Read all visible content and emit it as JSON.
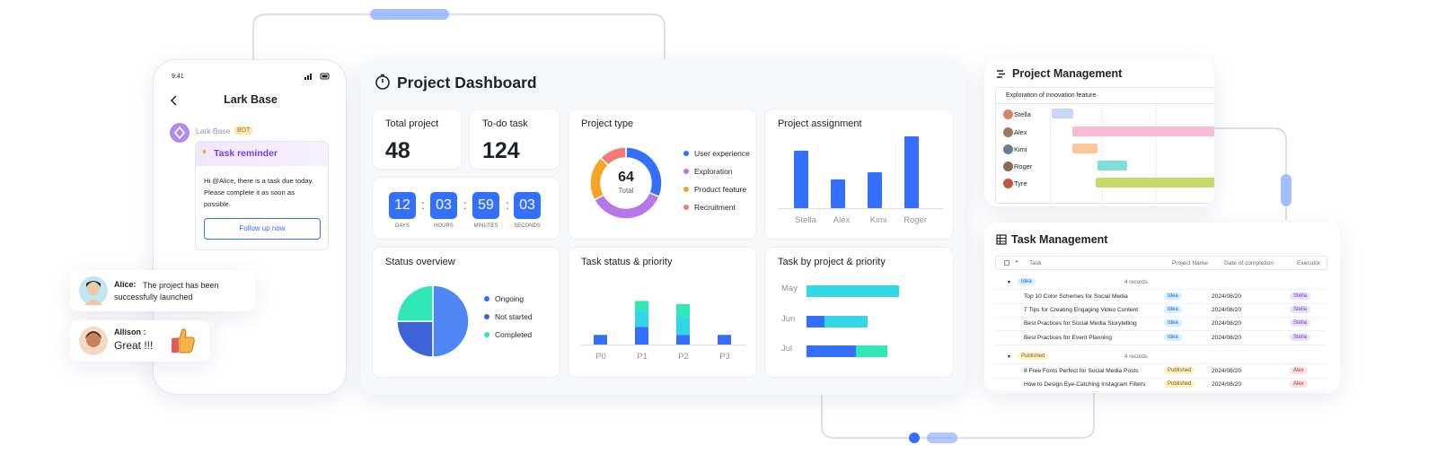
{
  "colors": {
    "accent": "#3370ff",
    "teal": "#2dd4bf",
    "cyan": "#33d6e6",
    "purple": "#b678e8",
    "orange": "#f5a524",
    "coral": "#f37b73"
  },
  "phone": {
    "time": "9:41",
    "title": "Lark Base",
    "back_icon": "chevron-left-icon",
    "bot_name": "Lark Base",
    "bot_badge": "BOT",
    "reminder_title": "Task reminder",
    "reminder_icon": "bell-icon",
    "reminder_text": "Hi @Alice, there is a task due today. Please complete it as soon as possible.",
    "button": "Follow up now"
  },
  "bubbles": [
    {
      "name": "Alice:",
      "text": "The project has been successfully launched"
    },
    {
      "name": "Allison :",
      "text": "Great !!!",
      "emoji": "thumbs-up-icon"
    }
  ],
  "dashboard": {
    "title": "Project Dashboard",
    "title_icon": "stopwatch-icon",
    "total_project": {
      "label": "Total project",
      "value": "48"
    },
    "todo_task": {
      "label": "To-do task",
      "value": "124"
    },
    "countdown": [
      {
        "value": "12",
        "label": "DAYS"
      },
      {
        "value": "03",
        "label": "HOURS"
      },
      {
        "value": "59",
        "label": "MINUTES"
      },
      {
        "value": "03",
        "label": "SECONDS"
      }
    ],
    "project_type": {
      "title": "Project type",
      "center_value": "64",
      "center_label": "Total",
      "legend": [
        "User experience",
        "Exploration",
        "Product feature",
        "Recruitment"
      ]
    },
    "status_overview": {
      "title": "Status overview",
      "legend": [
        "Ongoing",
        "Not started",
        "Completed"
      ]
    },
    "project_assignment": {
      "title": "Project assignment"
    },
    "task_status_priority": {
      "title": "Task status & priority"
    },
    "task_by_project": {
      "title": "Task by project & priority"
    }
  },
  "chart_data": [
    {
      "type": "pie",
      "title": "Project type",
      "donut": true,
      "total": 64,
      "categories": [
        "User experience",
        "Exploration",
        "Product feature",
        "Recruitment"
      ],
      "values": [
        20,
        23,
        13,
        8
      ],
      "colors": [
        "#3370ff",
        "#b678e8",
        "#f5a524",
        "#f37b73"
      ]
    },
    {
      "type": "bar",
      "title": "Project assignment",
      "categories": [
        "Stella",
        "Alex",
        "Kimi",
        "Roger"
      ],
      "values": [
        8,
        4,
        5,
        10
      ],
      "ylim": [
        0,
        10
      ],
      "grid": false,
      "colors": [
        "#3370ff"
      ]
    },
    {
      "type": "pie",
      "title": "Status overview",
      "categories": [
        "Ongoing",
        "Not started",
        "Completed"
      ],
      "values": [
        50,
        25,
        25
      ],
      "colors": [
        "#4e86f6",
        "#3d63d9",
        "#2ee8b6"
      ]
    },
    {
      "type": "bar",
      "title": "Task status & priority",
      "stacked": true,
      "categories": [
        "P0",
        "P1",
        "P2",
        "P3"
      ],
      "ylim": [
        0,
        8
      ],
      "series": [
        {
          "values": [
            1.2,
            2.2,
            1.2,
            1.2
          ],
          "color": "#3370ff"
        },
        {
          "values": [
            0,
            2.0,
            2.2,
            0
          ],
          "color": "#33d6e6"
        },
        {
          "values": [
            0,
            1.2,
            1.6,
            0
          ],
          "color": "#2ee8b6"
        }
      ]
    },
    {
      "type": "bar",
      "orientation": "horizontal",
      "title": "Task by project & priority",
      "stacked": true,
      "categories": [
        "May",
        "Jun",
        "Jul"
      ],
      "xlim": [
        0,
        10
      ],
      "series": [
        {
          "values": [
            0,
            2,
            5.5
          ],
          "color": "#3370ff"
        },
        {
          "values": [
            10.3,
            4.8,
            0
          ],
          "color": "#33d6e6"
        },
        {
          "values": [
            0,
            0,
            3.5
          ],
          "color": "#2ee8b6"
        }
      ]
    }
  ],
  "project_management": {
    "title": "Project Management",
    "title_icon": "gantt-icon",
    "header": "Exploration of innovation feature",
    "rows": [
      {
        "name": "Stella",
        "color": "#c9d6fb"
      },
      {
        "name": "Alex",
        "color": "#f7bbd6"
      },
      {
        "name": "Kimi",
        "color": "#fbc79b"
      },
      {
        "name": "Roger",
        "color": "#7ee0d4"
      },
      {
        "name": "Tyre",
        "color": "#c8db6a"
      }
    ]
  },
  "task_management": {
    "title": "Task Management",
    "title_icon": "table-icon",
    "columns": {
      "task": "Task",
      "project": "Project Name",
      "date": "Date of completion",
      "executor": "Executor"
    },
    "groups": [
      {
        "tag": "Idea",
        "records": "4 records",
        "rows": [
          {
            "task": "Top 10 Color Schemes for Social Media",
            "project": "Idea",
            "date": "2024/08/20",
            "executor": "Stella"
          },
          {
            "task": "7 Tips for Creating Engaging Video Content",
            "project": "Idea",
            "date": "2024/08/20",
            "executor": "Stella"
          },
          {
            "task": "Best Practices for Social Media Storytelling",
            "project": "Idea",
            "date": "2024/08/20",
            "executor": "Stella"
          },
          {
            "task": "Best Practices for Event Planning",
            "project": "Idea",
            "date": "2024/08/20",
            "executor": "Stella"
          }
        ]
      },
      {
        "tag": "Published",
        "records": "4 records",
        "rows": [
          {
            "task": "8 Free Fonts Perfect for Social Media Posts",
            "project": "Published",
            "date": "2024/08/20",
            "executor": "Alex"
          },
          {
            "task": "How to Design Eye-Catching Instagram Filters",
            "project": "Published",
            "date": "2024/08/20",
            "executor": "Alex"
          }
        ]
      }
    ]
  }
}
